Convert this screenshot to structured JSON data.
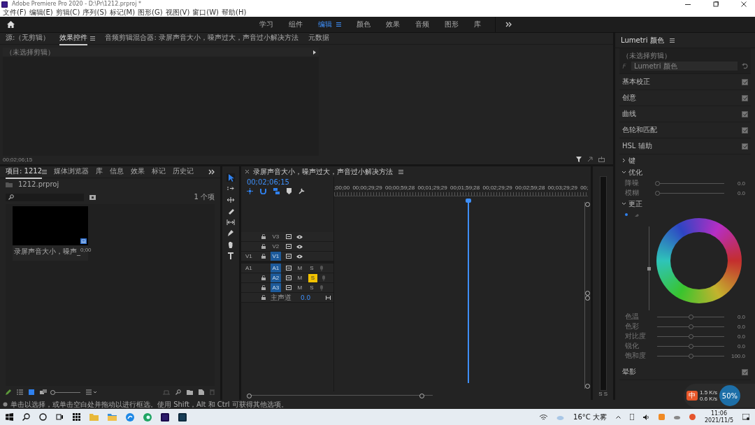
{
  "window": {
    "title": "Adobe Premiere Pro 2020 - D:\\Pr\\1212.prproj *"
  },
  "menu": [
    "文件(F)",
    "编辑(E)",
    "剪辑(C)",
    "序列(S)",
    "标记(M)",
    "图形(G)",
    "视图(V)",
    "窗口(W)",
    "帮助(H)"
  ],
  "workspaces": [
    {
      "label": "学习",
      "selected": false
    },
    {
      "label": "组件",
      "selected": false
    },
    {
      "label": "编辑",
      "selected": true
    },
    {
      "label": "颜色",
      "selected": false
    },
    {
      "label": "效果",
      "selected": false
    },
    {
      "label": "音频",
      "selected": false
    },
    {
      "label": "图形",
      "selected": false
    },
    {
      "label": "库",
      "selected": false
    }
  ],
  "source_panel": {
    "tabs": [
      {
        "label": "源:（无剪辑）",
        "selected": false
      },
      {
        "label": "效果控件",
        "selected": true
      },
      {
        "label": "音频剪辑混合器: 录屏声音大小，噪声过大，声音过小解决方法",
        "selected": false
      },
      {
        "label": "元数据",
        "selected": false
      }
    ],
    "header": "（未选择剪辑）",
    "timecode": "00;02;06;15"
  },
  "project_panel": {
    "tabs": [
      {
        "label": "项目: 1212",
        "selected": true
      },
      {
        "label": "媒体浏览器",
        "selected": false
      },
      {
        "label": "库",
        "selected": false
      },
      {
        "label": "信息",
        "selected": false
      },
      {
        "label": "效果",
        "selected": false
      },
      {
        "label": "标记",
        "selected": false
      },
      {
        "label": "历史记",
        "selected": false
      }
    ],
    "file": "1212.prproj",
    "count": "1 个项",
    "zoom": {
      "level": 0
    },
    "clips": [
      {
        "name": "录屏声音大小，噪声_",
        "duration": "0;00"
      }
    ]
  },
  "timeline": {
    "title": "录屏声音大小，噪声过大，声音过小解决方法",
    "timecode": "00;02;06;15",
    "ruler": [
      ";00;00",
      "00;00;29;29",
      "00;00;59;28",
      "00;01;29;29",
      "00;01;59;28",
      "00;02;29;29",
      "00;02;59;28",
      "00;03;29;29",
      "00;"
    ],
    "video_tracks": [
      {
        "name": "V3",
        "targeted": false
      },
      {
        "name": "V2",
        "targeted": false
      },
      {
        "source": "V1",
        "name": "V1",
        "targeted": true
      }
    ],
    "audio_tracks": [
      {
        "source": "A1",
        "name": "A1",
        "targeted": true,
        "mute": "M",
        "solo_label": "S",
        "solo": false
      },
      {
        "name": "A2",
        "targeted": true,
        "mute": "M",
        "solo_label": "S",
        "solo": true
      },
      {
        "name": "A3",
        "targeted": true,
        "mute": "M",
        "solo_label": "S",
        "solo": false
      }
    ],
    "master": {
      "label": "主声道",
      "value": "0.0"
    }
  },
  "meter": {
    "solo": [
      "S",
      "S"
    ]
  },
  "lumetri": {
    "title": "Lumetri 颜色",
    "clip": "（未选择剪辑）",
    "effect": "Lumetri 颜色",
    "sections": [
      {
        "label": "基本校正",
        "checked": true
      },
      {
        "label": "创意",
        "checked": true
      },
      {
        "label": "曲线",
        "checked": true
      },
      {
        "label": "色轮和匹配",
        "checked": true
      },
      {
        "label": "HSL 辅助",
        "checked": true
      }
    ],
    "groups": [
      {
        "label": "键",
        "expanded": false
      },
      {
        "label": "优化",
        "expanded": true,
        "sliders": [
          {
            "label": "降噪",
            "level": 0,
            "reading": "0.0"
          },
          {
            "label": "模糊",
            "level": 0,
            "reading": "0.0"
          }
        ]
      },
      {
        "label": "更正",
        "expanded": true,
        "wheel": true,
        "intensity": {
          "level": 0.5
        },
        "sliders": [
          {
            "label": "色温",
            "level": 0.5,
            "reading": "0.0"
          },
          {
            "label": "色彩",
            "level": 0.5,
            "reading": "0.0"
          },
          {
            "label": "对比度",
            "level": 0.5,
            "reading": "0.0"
          },
          {
            "label": "锐化",
            "level": 0.5,
            "reading": "0.0"
          },
          {
            "label": "饱和度",
            "level": 0.5,
            "reading": "100.0"
          }
        ]
      }
    ],
    "vignette": {
      "label": "晕影",
      "checked": true
    }
  },
  "status_bar": "单击以选择，或单击空白处并拖动以进行框选。使用 Shift，Alt 和 Ctrl 可获得其他选项。",
  "widget": {
    "ime": "中",
    "upload": "1.5 K/s",
    "download": "0.6 K/s",
    "load": "50%"
  },
  "taskbar": {
    "weather": "16°C 大雾",
    "time": "11:06",
    "date": "2021/11/5"
  }
}
